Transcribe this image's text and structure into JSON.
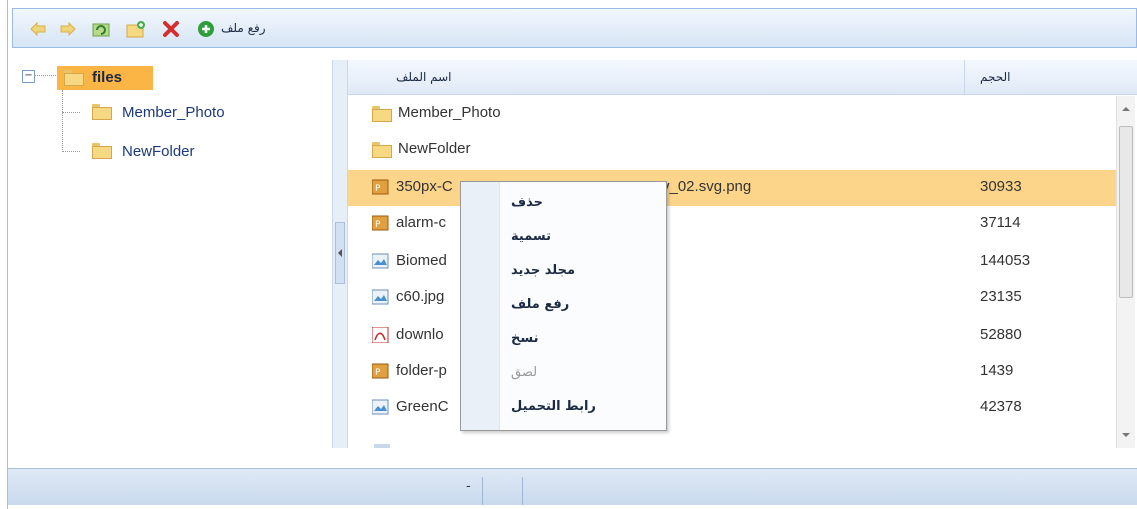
{
  "toolbar": {
    "upload_label": "رفع ملف"
  },
  "tree": {
    "root_label": "files",
    "children": [
      {
        "label": "Member_Photo"
      },
      {
        "label": "NewFolder"
      }
    ]
  },
  "grid": {
    "columns": {
      "name": "اسم الملف",
      "size": "الحجم"
    },
    "rows": [
      {
        "name": "Member_Photo",
        "size": "",
        "type": "folder"
      },
      {
        "name": "NewFolder",
        "size": "",
        "type": "folder"
      },
      {
        "name": "350px-C",
        "name_tail": "v_02.svg.png",
        "size": "30933",
        "type": "png",
        "selected": true
      },
      {
        "name": "alarm-c",
        "size": "37114",
        "type": "png"
      },
      {
        "name": "Biomed",
        "size": "144053",
        "type": "image"
      },
      {
        "name": "c60.jpg",
        "size": "23135",
        "type": "image"
      },
      {
        "name": "downlo",
        "size": "52880",
        "type": "pdf"
      },
      {
        "name": "folder-p",
        "size": "1439",
        "type": "png"
      },
      {
        "name": "GreenC",
        "size": "42378",
        "type": "image"
      }
    ]
  },
  "context_menu": {
    "items": [
      {
        "label": "حذف",
        "enabled": true
      },
      {
        "label": "تسمية",
        "enabled": true
      },
      {
        "label": "مجلد جديد",
        "enabled": true
      },
      {
        "label": "رفع ملف",
        "enabled": true
      },
      {
        "label": "نسخ",
        "enabled": true
      },
      {
        "label": "لصق",
        "enabled": false
      },
      {
        "label": "رابط التحميل",
        "enabled": true
      }
    ]
  },
  "statusbar": {
    "text": "-"
  },
  "icons": {
    "back": "arrow-left-icon",
    "forward": "arrow-right-icon",
    "refresh": "refresh-icon",
    "new_folder": "new-folder-icon",
    "delete": "delete-icon",
    "upload": "upload-icon"
  }
}
